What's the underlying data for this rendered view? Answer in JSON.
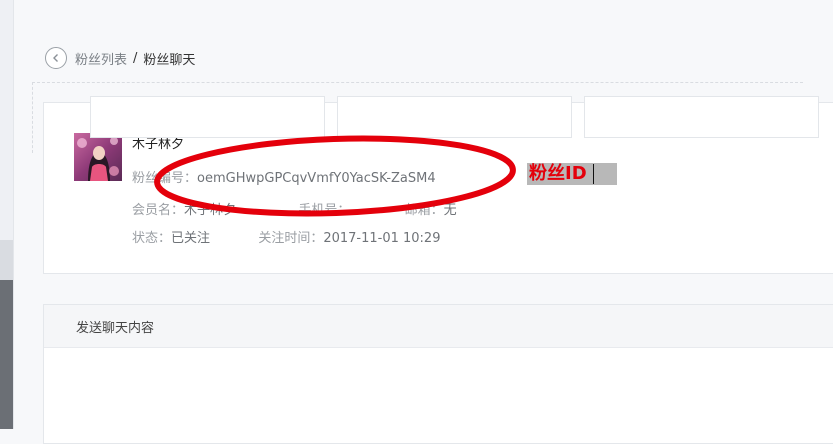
{
  "breadcrumb": {
    "parent": "粉丝列表",
    "separator": "/",
    "current": "粉丝聊天"
  },
  "profile": {
    "nickname": "木子林夕",
    "fan_id_label": "粉丝编号：",
    "fan_id_value": "oemGHwpGPCqvVmfY0YacSK-ZaSM4",
    "member_label": "会员名：",
    "member_value": "木子林夕",
    "phone_label": "手机号：",
    "phone_value": "",
    "email_label": "邮箱：",
    "email_value": "无",
    "status_label": "状态：",
    "status_value": "已关注",
    "follow_time_label": "关注时间：",
    "follow_time_value": "2017-11-01 10:29"
  },
  "chat": {
    "header": "发送聊天内容"
  },
  "annotation": {
    "label": "粉丝ID",
    "color": "#e4000b"
  },
  "icons": {
    "back": "chevron-left-circle-icon"
  }
}
